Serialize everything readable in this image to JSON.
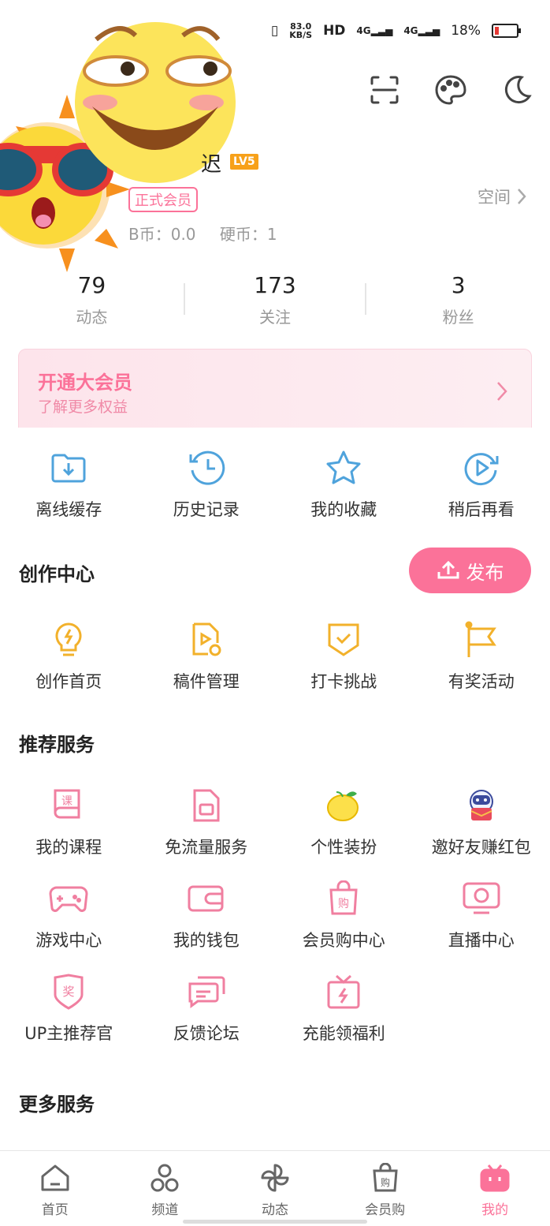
{
  "status_bar": {
    "speed_value": "83.0",
    "speed_unit": "KB/S",
    "hd": "HD",
    "net1": "4G",
    "net2": "4G",
    "battery": "18%"
  },
  "header": {
    "icons": [
      "scan-icon",
      "palette-icon",
      "night-mode-icon"
    ]
  },
  "profile": {
    "name_fragment": "迟",
    "level": "LV5",
    "vip_tag": "正式会员",
    "b_coin": "B币：0.0",
    "coin": "硬币：1",
    "space_label": "空间"
  },
  "stats": [
    {
      "value": "79",
      "label": "动态"
    },
    {
      "value": "173",
      "label": "关注"
    },
    {
      "value": "3",
      "label": "粉丝"
    }
  ],
  "vip_banner": {
    "title": "开通大会员",
    "subtitle": "了解更多权益"
  },
  "quick_actions": [
    {
      "label": "离线缓存",
      "icon": "download-folder-icon"
    },
    {
      "label": "历史记录",
      "icon": "history-clock-icon"
    },
    {
      "label": "我的收藏",
      "icon": "star-icon"
    },
    {
      "label": "稍后再看",
      "icon": "watch-later-icon"
    }
  ],
  "creation_center": {
    "title": "创作中心",
    "publish_label": "发布",
    "items": [
      {
        "label": "创作首页",
        "icon": "bulb-icon"
      },
      {
        "label": "稿件管理",
        "icon": "manuscript-icon"
      },
      {
        "label": "打卡挑战",
        "icon": "checkin-icon"
      },
      {
        "label": "有奖活动",
        "icon": "flag-icon"
      }
    ]
  },
  "recommended": {
    "title": "推荐服务",
    "items": [
      {
        "label": "我的课程",
        "icon": "course-icon"
      },
      {
        "label": "免流量服务",
        "icon": "sim-card-icon"
      },
      {
        "label": "个性装扮",
        "icon": "lemon-icon"
      },
      {
        "label": "邀好友赚红包",
        "icon": "invite-mascot-icon"
      },
      {
        "label": "游戏中心",
        "icon": "gamepad-icon"
      },
      {
        "label": "我的钱包",
        "icon": "wallet-icon"
      },
      {
        "label": "会员购中心",
        "icon": "shopping-bag-icon"
      },
      {
        "label": "直播中心",
        "icon": "live-tv-icon"
      },
      {
        "label": "UP主推荐官",
        "icon": "award-badge-icon"
      },
      {
        "label": "反馈论坛",
        "icon": "feedback-chat-icon"
      },
      {
        "label": "充能领福利",
        "icon": "gift-icon"
      }
    ]
  },
  "more_services": {
    "title": "更多服务"
  },
  "bottom_nav": [
    {
      "label": "首页",
      "icon": "home-icon"
    },
    {
      "label": "频道",
      "icon": "channel-icon"
    },
    {
      "label": "动态",
      "icon": "pinwheel-icon"
    },
    {
      "label": "会员购",
      "icon": "shop-bag-icon"
    },
    {
      "label": "我的",
      "icon": "tv-mine-icon",
      "active": true
    }
  ],
  "colors": {
    "accent": "#fb7299",
    "icon_blue": "#4fa3dc",
    "icon_yellow": "#f2b12b",
    "icon_pink": "#f07fa0"
  }
}
